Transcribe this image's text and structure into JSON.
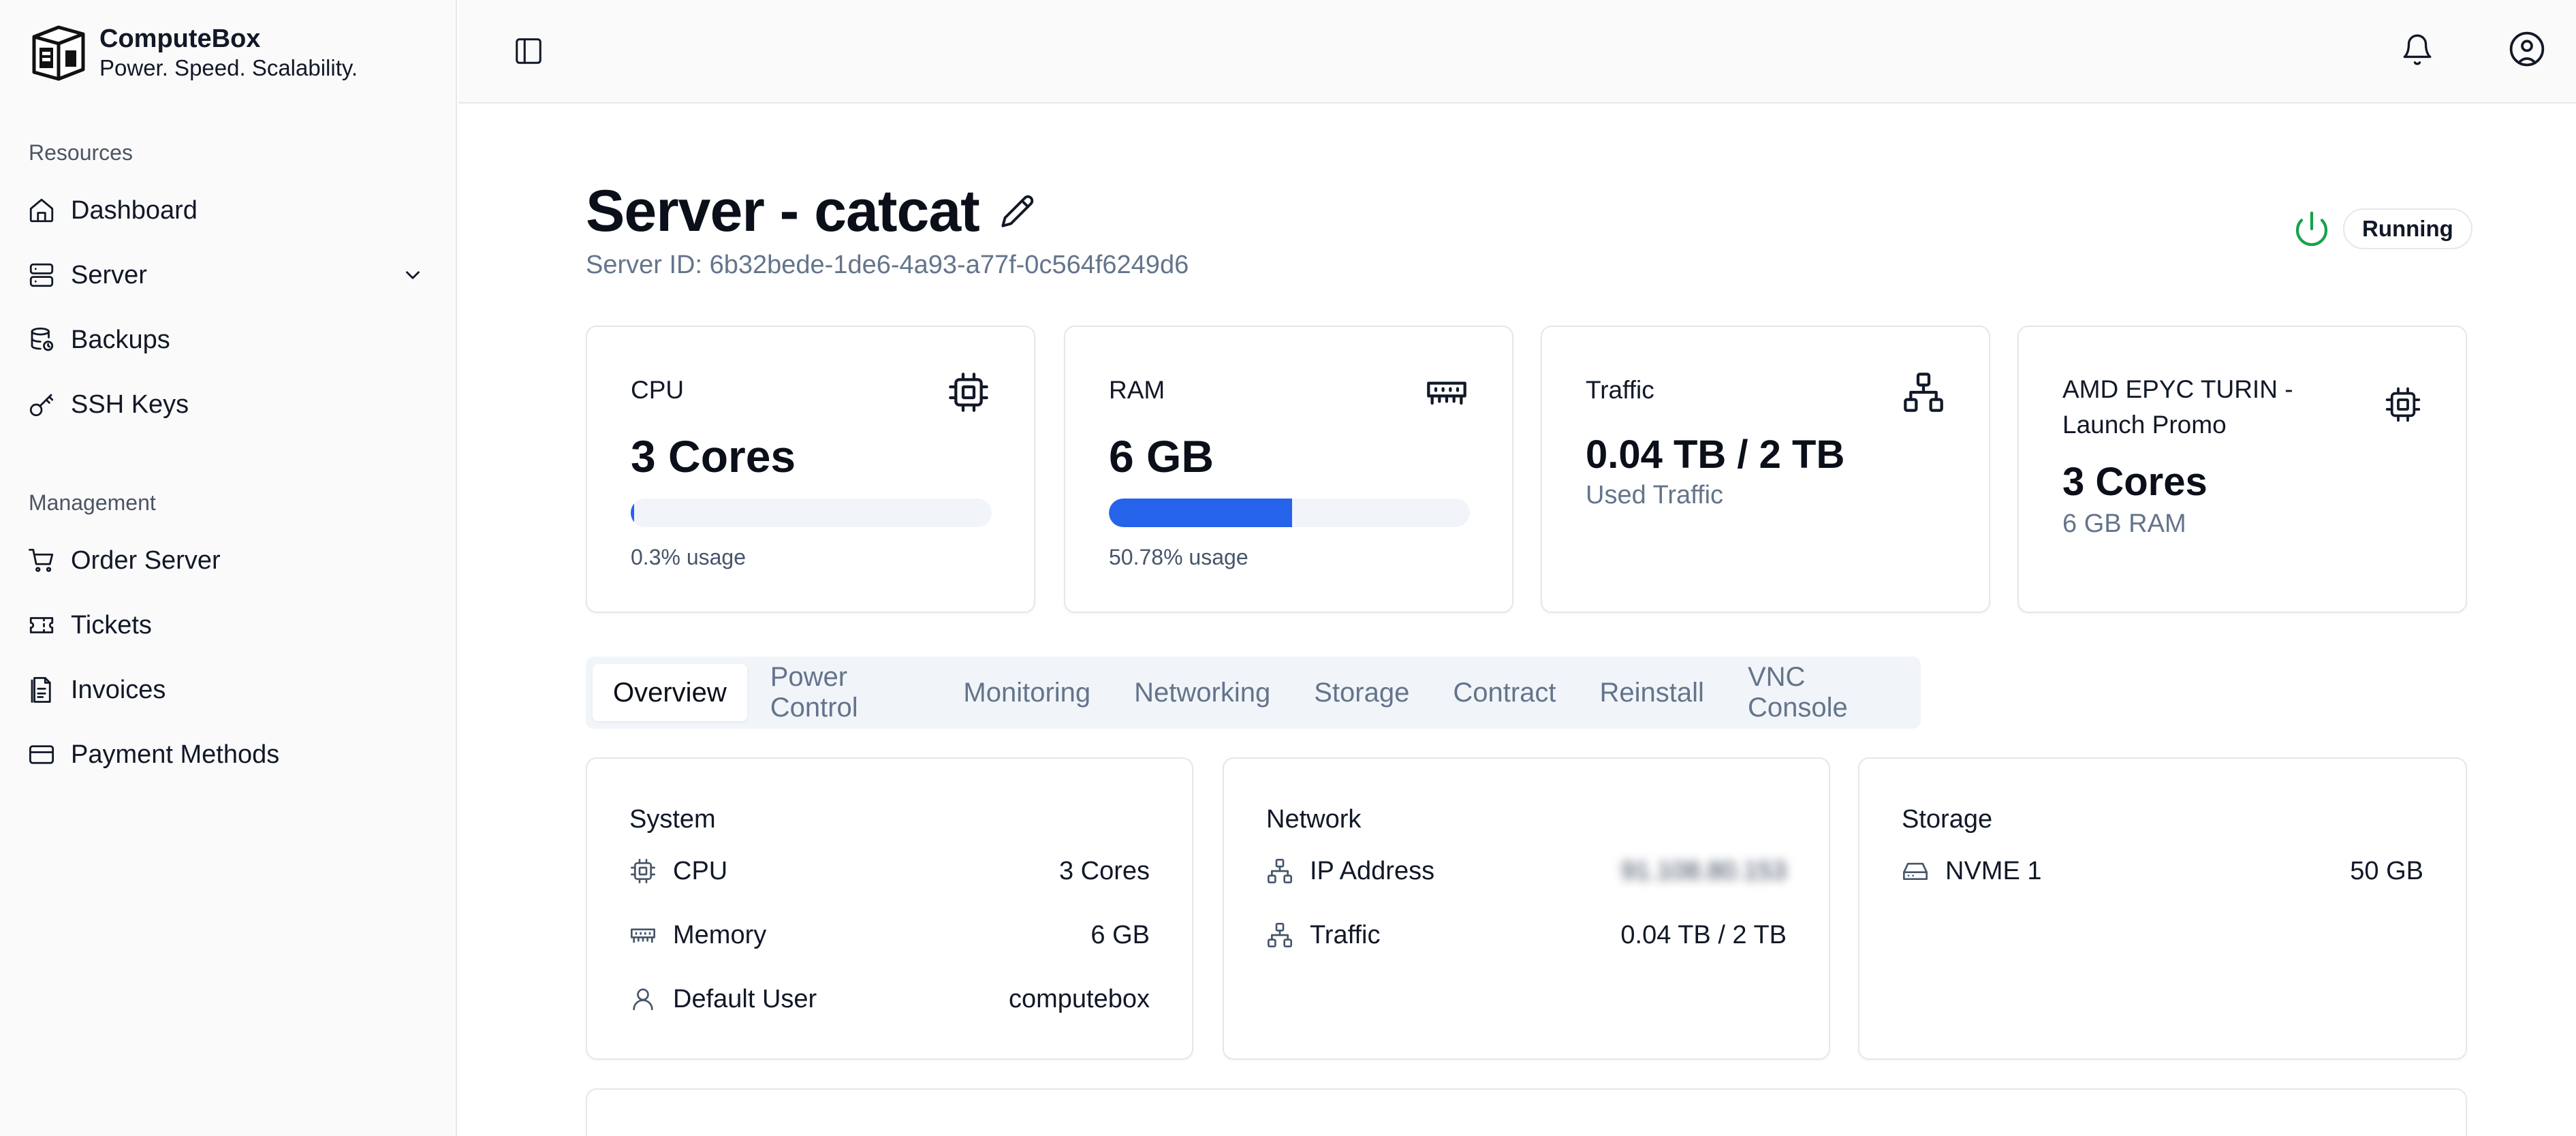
{
  "brand": {
    "name": "ComputeBox",
    "tagline": "Power. Speed. Scalability."
  },
  "sidebar": {
    "groups": [
      {
        "label": "Resources",
        "items": [
          {
            "label": "Dashboard",
            "icon": "home-icon"
          },
          {
            "label": "Server",
            "icon": "server-icon"
          },
          {
            "label": "Backups",
            "icon": "database-icon"
          },
          {
            "label": "SSH Keys",
            "icon": "key-icon"
          }
        ]
      },
      {
        "label": "Management",
        "items": [
          {
            "label": "Order Server",
            "icon": "cart-icon"
          },
          {
            "label": "Tickets",
            "icon": "ticket-icon"
          },
          {
            "label": "Invoices",
            "icon": "invoice-icon"
          },
          {
            "label": "Payment Methods",
            "icon": "credit-card-icon"
          }
        ]
      }
    ]
  },
  "page": {
    "title": "Server - catcat",
    "server_id": "Server ID: 6b32bede-1de6-4a93-a77f-0c564f6249d6",
    "status": "Running"
  },
  "stats": {
    "cpu": {
      "label": "CPU",
      "value": "3 Cores",
      "usage_label": "0.3% usage",
      "usage_percent": 0.3
    },
    "ram": {
      "label": "RAM",
      "value": "6 GB",
      "usage_label": "50.78% usage",
      "usage_percent": 50.78
    },
    "traffic": {
      "label": "Traffic",
      "value": "0.04 TB / 2 TB",
      "sub": "Used Traffic"
    },
    "plan": {
      "label": "AMD EPYC TURIN - Launch Promo",
      "value": "3 Cores",
      "sub": "6 GB RAM"
    }
  },
  "tabs": [
    "Overview",
    "Power Control",
    "Monitoring",
    "Networking",
    "Storage",
    "Contract",
    "Reinstall",
    "VNC Console"
  ],
  "details": {
    "system": {
      "title": "System",
      "rows": [
        {
          "label": "CPU",
          "value": "3 Cores"
        },
        {
          "label": "Memory",
          "value": "6 GB"
        },
        {
          "label": "Default User",
          "value": "computebox"
        }
      ]
    },
    "network": {
      "title": "Network",
      "rows": [
        {
          "label": "IP Address",
          "value": "91.108.80.153"
        },
        {
          "label": "Traffic",
          "value": "0.04 TB / 2 TB"
        }
      ]
    },
    "storage": {
      "title": "Storage",
      "rows": [
        {
          "label": "NVME 1",
          "value": "50 GB"
        }
      ]
    }
  },
  "colors": {
    "accent": "#2563eb",
    "status_running": "#16a34a",
    "muted_text": "#64748b"
  }
}
